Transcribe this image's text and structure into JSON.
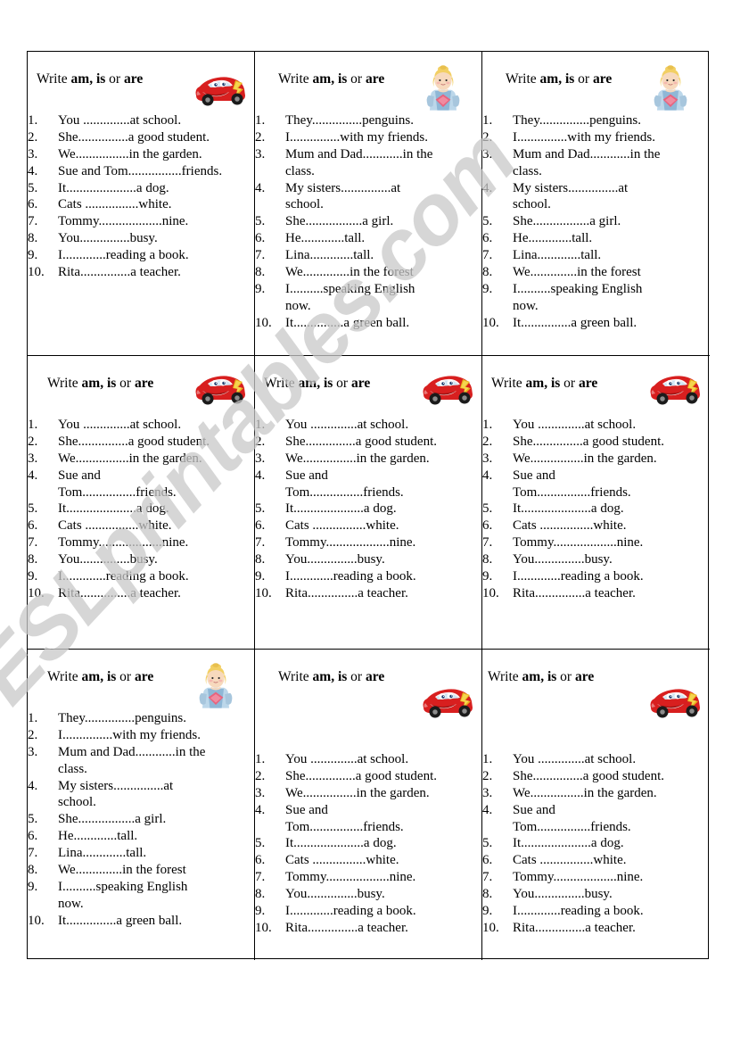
{
  "watermark": {
    "text": "ESLprintables.com",
    "color": "#c9c9c9"
  },
  "heading": {
    "write": "Write ",
    "am_is": "am, is",
    "or": " or ",
    "are": "are"
  },
  "clipart": {
    "car": {
      "name": "lightning-mcqueen-car",
      "body_color": "#d81f1f",
      "bolt_color": "#e8b21c"
    },
    "fairy": {
      "name": "blonde-fairy-with-heart",
      "hair_color": "#f2cf63",
      "dress_color": "#bcd7ea",
      "heart_color": "#e8637d"
    }
  },
  "sets": {
    "school": [
      {
        "n": "1.",
        "text": "You ..............at school."
      },
      {
        "n": "2.",
        "text": "She...............a good student."
      },
      {
        "n": "3.",
        "text": "We................in the garden."
      },
      {
        "n": "4.",
        "text": "Sue and Tom................friends."
      },
      {
        "n": "5.",
        "text": "It.....................a dog."
      },
      {
        "n": "6.",
        "text": "Cats ................white."
      },
      {
        "n": "7.",
        "text": "Tommy...................nine."
      },
      {
        "n": "8.",
        "text": "You...............busy."
      },
      {
        "n": "9.",
        "text": "I.............reading a book."
      },
      {
        "n": "10.",
        "text": "Rita...............a teacher."
      }
    ],
    "penguins": [
      {
        "n": "1.",
        "text": "They...............penguins."
      },
      {
        "n": "2.",
        "text": "I...............with my friends."
      },
      {
        "n": "3.",
        "text": "Mum and Dad............in the class."
      },
      {
        "n": "4.",
        "text": "My sisters...............at school."
      },
      {
        "n": "5.",
        "text": "She.................a girl."
      },
      {
        "n": "6.",
        "text": "He.............tall."
      },
      {
        "n": "7.",
        "text": "Lina.............tall."
      },
      {
        "n": "8.",
        "text": "We..............in the forest"
      },
      {
        "n": "9.",
        "text": "I..........speaking English now."
      },
      {
        "n": "10.",
        "text": "It...............a green ball."
      }
    ]
  },
  "cells": [
    {
      "id": "cell-r1c1",
      "set": "school",
      "art": "car"
    },
    {
      "id": "cell-r1c2",
      "set": "penguins",
      "art": "fairy"
    },
    {
      "id": "cell-r1c3",
      "set": "penguins",
      "art": "fairy"
    },
    {
      "id": "cell-r2c1",
      "set": "school",
      "art": "car"
    },
    {
      "id": "cell-r2c2",
      "set": "school",
      "art": "car"
    },
    {
      "id": "cell-r2c3",
      "set": "school",
      "art": "car"
    },
    {
      "id": "cell-r3c1",
      "set": "penguins",
      "art": "fairy"
    },
    {
      "id": "cell-r3c2",
      "set": "school",
      "art": "car"
    },
    {
      "id": "cell-r3c3",
      "set": "school",
      "art": "car"
    }
  ]
}
